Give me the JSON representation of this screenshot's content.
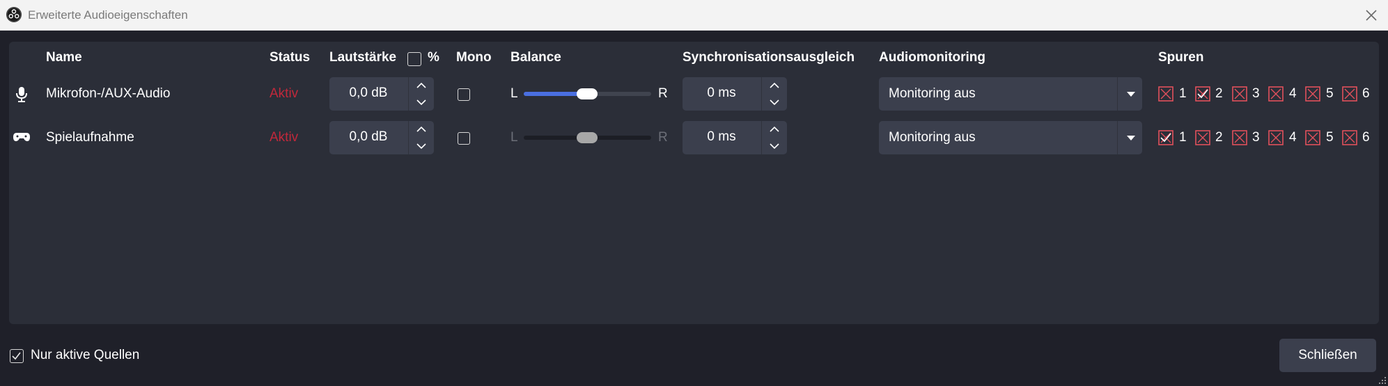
{
  "window": {
    "title": "Erweiterte Audioeigenschaften"
  },
  "columns": {
    "name": "Name",
    "status": "Status",
    "volume": "Lautstärke",
    "percent": "%",
    "mono": "Mono",
    "balance": "Balance",
    "sync": "Synchronisationsausgleich",
    "monitoring": "Audiomonitoring",
    "tracks": "Spuren"
  },
  "rows": [
    {
      "icon": "microphone-icon",
      "name": "Mikrofon-/AUX-Audio",
      "status": "Aktiv",
      "volume": "0,0 dB",
      "mono": false,
      "balance_left": "L",
      "balance_right": "R",
      "balance_value": 0.5,
      "sync": "0 ms",
      "monitoring": "Monitoring aus",
      "tracks": [
        "1",
        "2",
        "3",
        "4",
        "5",
        "6"
      ]
    },
    {
      "icon": "gamepad-icon",
      "name": "Spielaufnahme",
      "status": "Aktiv",
      "volume": "0,0 dB",
      "mono": false,
      "balance_left": "L",
      "balance_right": "R",
      "balance_value": 0.5,
      "sync": "0 ms",
      "monitoring": "Monitoring aus",
      "tracks": [
        "1",
        "2",
        "3",
        "4",
        "5",
        "6"
      ]
    }
  ],
  "footer": {
    "active_only_label": "Nur aktive Quellen",
    "active_only_checked": true,
    "close_label": "Schließen"
  },
  "colors": {
    "status_active": "#c2283b",
    "slider_active": "#4a6fe0",
    "track_checkbox": "#e2505c"
  }
}
